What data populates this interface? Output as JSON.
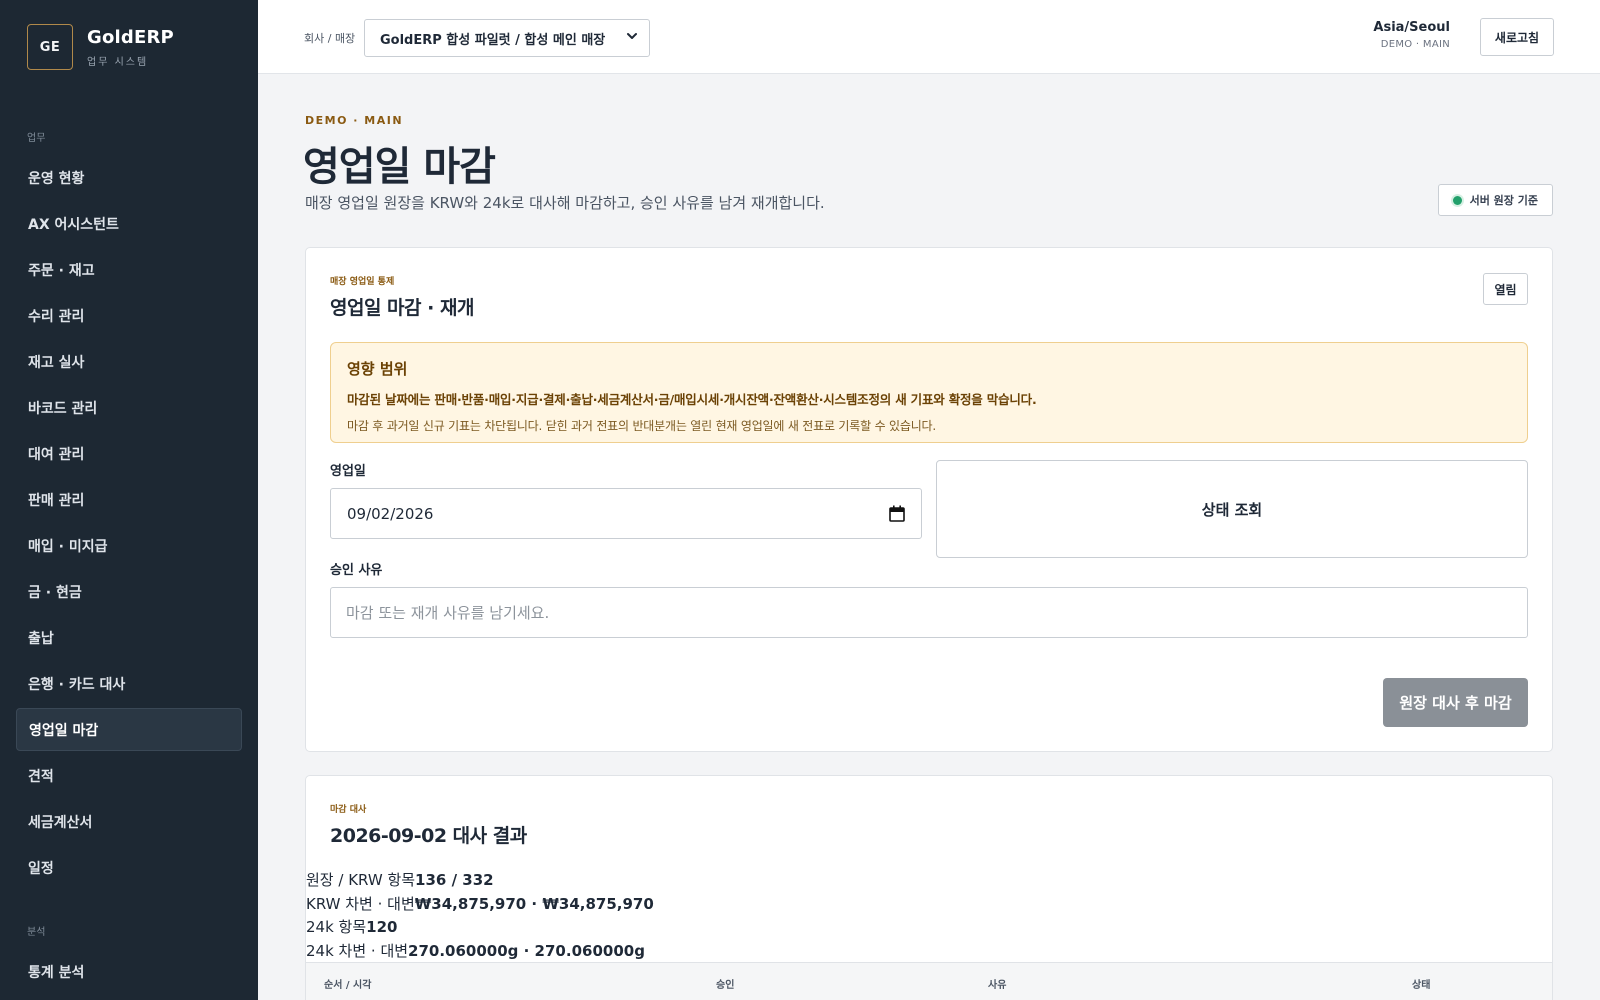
{
  "brand": {
    "logo": "GE",
    "name": "GoldERP",
    "sub": "업무 시스템"
  },
  "nav": {
    "section_work": "업무",
    "section_analysis": "분석",
    "items": [
      {
        "label": "운영 현황",
        "active": false
      },
      {
        "label": "AX 어시스턴트",
        "active": false
      },
      {
        "label": "주문 · 재고",
        "active": false
      },
      {
        "label": "수리 관리",
        "active": false
      },
      {
        "label": "재고 실사",
        "active": false
      },
      {
        "label": "바코드 관리",
        "active": false
      },
      {
        "label": "대여 관리",
        "active": false
      },
      {
        "label": "판매 관리",
        "active": false
      },
      {
        "label": "매입 · 미지급",
        "active": false
      },
      {
        "label": "금 · 현금",
        "active": false
      },
      {
        "label": "출납",
        "active": false
      },
      {
        "label": "은행 · 카드 대사",
        "active": false
      },
      {
        "label": "영업일 마감",
        "active": true
      },
      {
        "label": "견적",
        "active": false
      },
      {
        "label": "세금계산서",
        "active": false
      },
      {
        "label": "일정",
        "active": false
      }
    ],
    "analysis_items": [
      {
        "label": "통계 분석"
      }
    ]
  },
  "topbar": {
    "store_label": "회사 / 매장",
    "store_value": "GoldERP 합성 파일럿 / 합성 메인 매장",
    "timezone": "Asia/Seoul",
    "timezone_sub": "DEMO · MAIN",
    "refresh": "새로고침"
  },
  "page": {
    "eyebrow": "DEMO · MAIN",
    "title": "영업일 마감",
    "description": "매장 영업일 원장을 KRW와 24k로 대사해 마감하고, 승인 사유를 남겨 재개합니다.",
    "source_badge": "서버 원장 기준",
    "source_color": "#22a06b"
  },
  "control_card": {
    "eyebrow": "매장 영업일 통제",
    "title": "영업일 마감 · 재개",
    "status": "열림",
    "impact_title": "영향 범위",
    "impact_main": "마감된 날짜에는 판매·반품·매입·지급·결제·출납·세금계산서·금/매입시세·개시잔액·잔액환산·시스템조정의 새 기표와 확정을 막습니다.",
    "impact_sub": "마감 후 과거일 신규 기표는 차단됩니다. 닫힌 과거 전표의 반대분개는 열린 현재 영업일에 새 전표로 기록할 수 있습니다.",
    "date_label": "영업일",
    "date_value": "09/02/2026",
    "lookup_button": "상태 조회",
    "reason_label": "승인 사유",
    "reason_placeholder": "마감 또는 재개 사유를 남기세요.",
    "reason_value": "",
    "close_button": "원장 대사 후 마감"
  },
  "result_card": {
    "eyebrow": "마감 대사",
    "title": "2026-09-02 대사 결과",
    "summary": [
      {
        "label": "원장 / KRW 항목",
        "value": "136 / 332"
      },
      {
        "label": "KRW 차변 · 대변",
        "value": "₩34,875,970 · ₩34,875,970"
      },
      {
        "label": "24k 항목",
        "value": "120"
      },
      {
        "label": "24k 차변 · 대변",
        "value": "270.060000g · 270.060000g"
      }
    ],
    "columns": [
      "순서 / 시각",
      "승인",
      "사유",
      "상태"
    ]
  }
}
